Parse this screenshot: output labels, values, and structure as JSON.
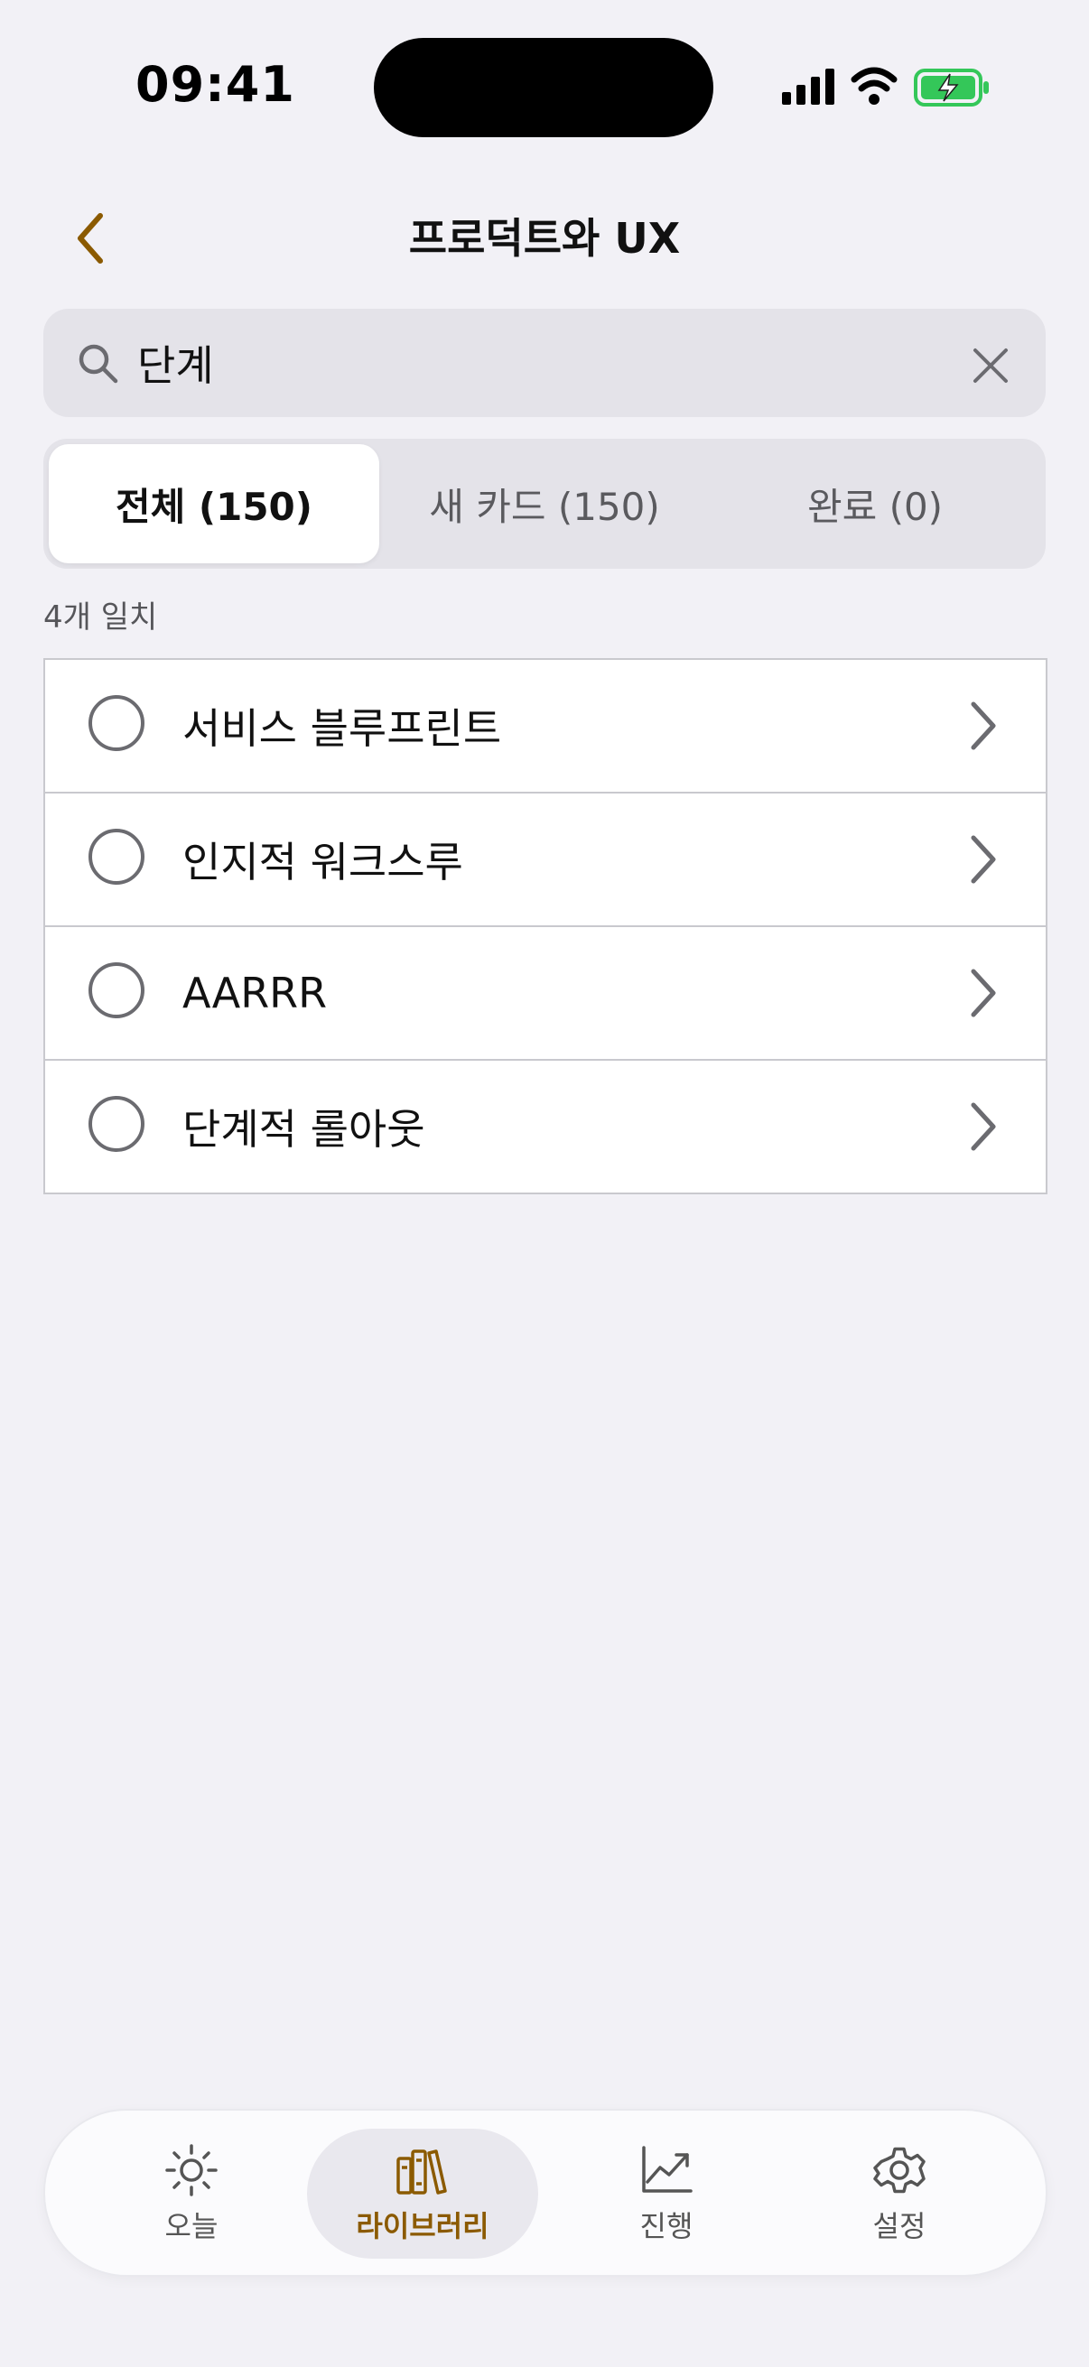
{
  "status_bar": {
    "time": "09:41"
  },
  "nav": {
    "title": "프로덕트와 UX"
  },
  "search": {
    "value": "단계"
  },
  "segments": [
    {
      "label": "전체 (150)",
      "selected": true
    },
    {
      "label": "새 카드 (150)",
      "selected": false
    },
    {
      "label": "완료 (0)",
      "selected": false
    }
  ],
  "match_count": "4개 일치",
  "results": [
    {
      "title": "서비스 블루프린트"
    },
    {
      "title": "인지적 워크스루"
    },
    {
      "title": "AARRR"
    },
    {
      "title": "단계적 롤아웃"
    }
  ],
  "tab_bar": {
    "items": [
      {
        "label": "오늘",
        "icon": "sun-icon",
        "active": false
      },
      {
        "label": "라이브러리",
        "icon": "books-icon",
        "active": true
      },
      {
        "label": "진행",
        "icon": "chart-icon",
        "active": false
      },
      {
        "label": "설정",
        "icon": "gear-icon",
        "active": false
      }
    ]
  },
  "colors": {
    "accent": "#8B5A00",
    "background": "#F2F1F6",
    "battery_green": "#34C759"
  }
}
